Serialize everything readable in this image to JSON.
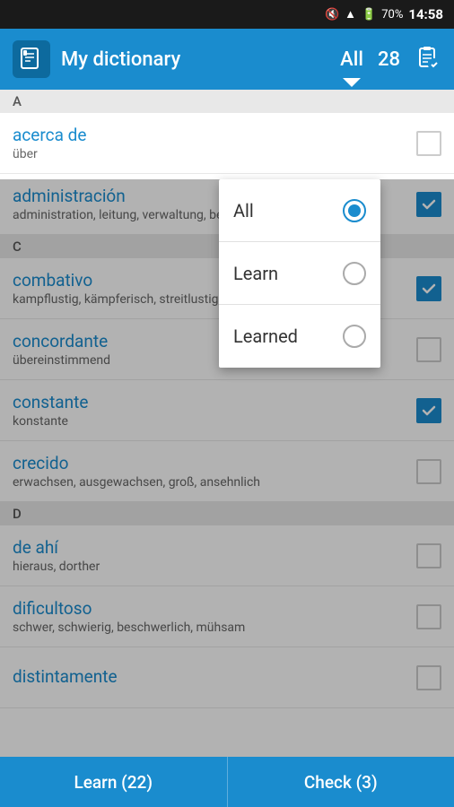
{
  "statusBar": {
    "time": "14:58",
    "battery": "70%",
    "signal": "▲"
  },
  "appBar": {
    "title": "My dictionary",
    "filter": "All",
    "count": "28",
    "icon": "book"
  },
  "dropdown": {
    "options": [
      {
        "label": "All",
        "value": "all",
        "selected": true
      },
      {
        "label": "Learn",
        "value": "learn",
        "selected": false
      },
      {
        "label": "Learned",
        "value": "learned",
        "selected": false
      }
    ]
  },
  "sections": [
    {
      "letter": "A",
      "words": [
        {
          "title": "acerca de",
          "translation": "über",
          "checked": false
        },
        {
          "title": "administración",
          "translation": "administration, leitung, verwaltung, behörde",
          "checked": true
        }
      ]
    },
    {
      "letter": "C",
      "words": [
        {
          "title": "combativo",
          "translation": "kampflustig, kämpferisch, streitlustig, streitbar",
          "checked": true
        },
        {
          "title": "concordante",
          "translation": "übereinstimmend",
          "checked": false
        },
        {
          "title": "constante",
          "translation": "konstante",
          "checked": true
        },
        {
          "title": "crecido",
          "translation": "erwachsen, ausgewachsen, groß, ansehnlich",
          "checked": false
        }
      ]
    },
    {
      "letter": "D",
      "words": [
        {
          "title": "de ahí",
          "translation": "hieraus, dorther",
          "checked": false
        },
        {
          "title": "dificultoso",
          "translation": "schwer, schwierig, beschwerlich, mühsam",
          "checked": false
        },
        {
          "title": "distintamente",
          "translation": "",
          "checked": false
        }
      ]
    }
  ],
  "bottomBar": {
    "learnBtn": "Learn (22)",
    "checkBtn": "Check (3)"
  }
}
